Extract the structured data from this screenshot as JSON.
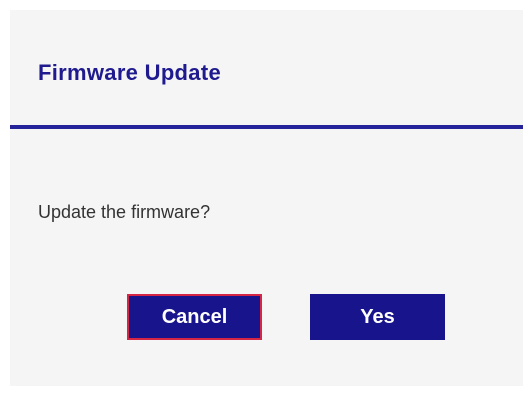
{
  "dialog": {
    "title": "Firmware Update",
    "message": "Update the firmware?",
    "cancel_label": "Cancel",
    "yes_label": "Yes"
  },
  "colors": {
    "accent": "#1f1b8f",
    "button_bg": "#17148c",
    "focus_border": "#d52645",
    "panel_bg": "#f5f5f5"
  }
}
